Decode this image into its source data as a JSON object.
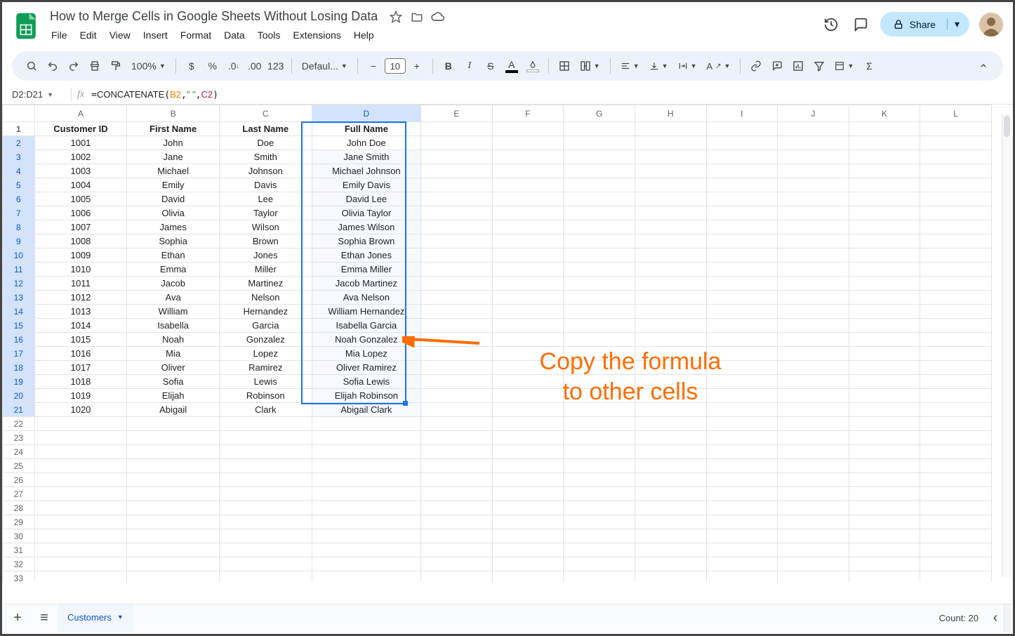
{
  "doc": {
    "title": "How to Merge Cells in Google Sheets Without Losing Data"
  },
  "menubar": [
    "File",
    "Edit",
    "View",
    "Insert",
    "Format",
    "Data",
    "Tools",
    "Extensions",
    "Help"
  ],
  "toolbar": {
    "zoom": "100%",
    "font": "Defaul...",
    "size": "10"
  },
  "name_box": "D2:D21",
  "formula": {
    "raw": "=CONCATENATE(B2,\" \",C2)",
    "fn": "CONCATENATE",
    "ref1": "B2",
    "str": "\" \"",
    "ref2": "C2"
  },
  "share_label": "Share",
  "columns": [
    "A",
    "B",
    "C",
    "D",
    "E",
    "F",
    "G",
    "H",
    "I",
    "J",
    "K",
    "L"
  ],
  "headers": {
    "A": "Customer ID",
    "B": "First Name",
    "C": "Last Name",
    "D": "Full Name"
  },
  "rows": [
    {
      "id": "1001",
      "first": "John",
      "last": "Doe",
      "full": "John Doe"
    },
    {
      "id": "1002",
      "first": "Jane",
      "last": "Smith",
      "full": "Jane Smith"
    },
    {
      "id": "1003",
      "first": "Michael",
      "last": "Johnson",
      "full": "Michael Johnson"
    },
    {
      "id": "1004",
      "first": "Emily",
      "last": "Davis",
      "full": "Emily Davis"
    },
    {
      "id": "1005",
      "first": "David",
      "last": "Lee",
      "full": "David Lee"
    },
    {
      "id": "1006",
      "first": "Olivia",
      "last": "Taylor",
      "full": "Olivia Taylor"
    },
    {
      "id": "1007",
      "first": "James",
      "last": "Wilson",
      "full": "James Wilson"
    },
    {
      "id": "1008",
      "first": "Sophia",
      "last": "Brown",
      "full": "Sophia Brown"
    },
    {
      "id": "1009",
      "first": "Ethan",
      "last": "Jones",
      "full": "Ethan Jones"
    },
    {
      "id": "1010",
      "first": "Emma",
      "last": "Miller",
      "full": "Emma Miller"
    },
    {
      "id": "1011",
      "first": "Jacob",
      "last": "Martinez",
      "full": "Jacob Martinez"
    },
    {
      "id": "1012",
      "first": "Ava",
      "last": "Nelson",
      "full": "Ava Nelson"
    },
    {
      "id": "1013",
      "first": "William",
      "last": "Hernandez",
      "full": "William Hernandez"
    },
    {
      "id": "1014",
      "first": "Isabella",
      "last": "Garcia",
      "full": "Isabella Garcia"
    },
    {
      "id": "1015",
      "first": "Noah",
      "last": "Gonzalez",
      "full": "Noah Gonzalez"
    },
    {
      "id": "1016",
      "first": "Mia",
      "last": "Lopez",
      "full": "Mia Lopez"
    },
    {
      "id": "1017",
      "first": "Oliver",
      "last": "Ramirez",
      "full": "Oliver Ramirez"
    },
    {
      "id": "1018",
      "first": "Sofia",
      "last": "Lewis",
      "full": "Sofia Lewis"
    },
    {
      "id": "1019",
      "first": "Elijah",
      "last": "Robinson",
      "full": "Elijah Robinson"
    },
    {
      "id": "1020",
      "first": "Abigail",
      "last": "Clark",
      "full": "Abigail Clark"
    }
  ],
  "empty_rows": 12,
  "annotation": {
    "line1": "Copy the formula",
    "line2": "to other cells"
  },
  "sheet_tab": "Customers",
  "count_label": "Count: 20"
}
